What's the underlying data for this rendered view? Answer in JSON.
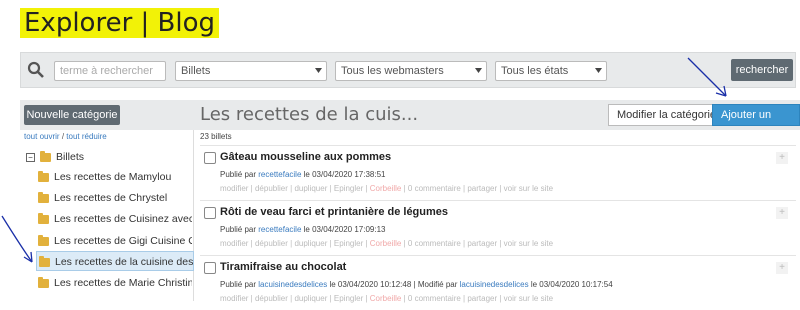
{
  "header": {
    "title": "Explorer | Blog"
  },
  "search": {
    "placeholder": "terme à rechercher",
    "type_value": "Billets",
    "webmasters_value": "Tous les webmasters",
    "states_value": "Tous les états",
    "button": "rechercher"
  },
  "sidebar": {
    "new_category": "Nouvelle catégorie",
    "open_all": "tout ouvrir",
    "separator": "/",
    "collapse_all": "tout réduire",
    "root": "Billets",
    "items": [
      {
        "label": "Les recettes de Mamylou"
      },
      {
        "label": "Les recettes de Chrystel"
      },
      {
        "label": "Les recettes de Cuisinez avec Fl"
      },
      {
        "label": "Les recettes de Gigi Cuisine Gou"
      },
      {
        "label": "Les recettes de la cuisine des dé"
      },
      {
        "label": "Les recettes de Marie Christine"
      }
    ]
  },
  "main": {
    "category_title": "Les recettes de la cuis...",
    "edit_category": "Modifier la catégorie",
    "add_post": "Ajouter un billet",
    "count": "23 billets",
    "posts": [
      {
        "title": "Gâteau mousseline aux pommes",
        "published": "Publié par",
        "author": "recettefacile",
        "date": "le 03/04/2020 17:38:51",
        "modified": "",
        "mod_author": "",
        "mod_date": ""
      },
      {
        "title": "Rôti de veau farci et printanière de légumes",
        "published": "Publié par",
        "author": "recettefacile",
        "date": "le 03/04/2020 17:09:13",
        "modified": "",
        "mod_author": "",
        "mod_date": ""
      },
      {
        "title": "Tiramifraise au chocolat",
        "published": "Publié par",
        "author": "lacuisinedesdelices",
        "date": "le 03/04/2020 10:12:48 |",
        "modified": "Modifié par",
        "mod_author": "lacuisinedesdelices",
        "mod_date": "le 03/04/2020 10:17:54"
      }
    ],
    "actions": {
      "modifier": "modifier",
      "depublier": "dépublier",
      "dupliquer": "dupliquer",
      "epingler": "Epingler",
      "corbeille": "Corbeille",
      "commentaires": "0 commentaire",
      "partager": "partager",
      "voir": "voir sur le site"
    }
  },
  "colors": {
    "highlight": "#f2f207",
    "accent": "#3a95d0",
    "arrow": "#1a2fa8"
  }
}
